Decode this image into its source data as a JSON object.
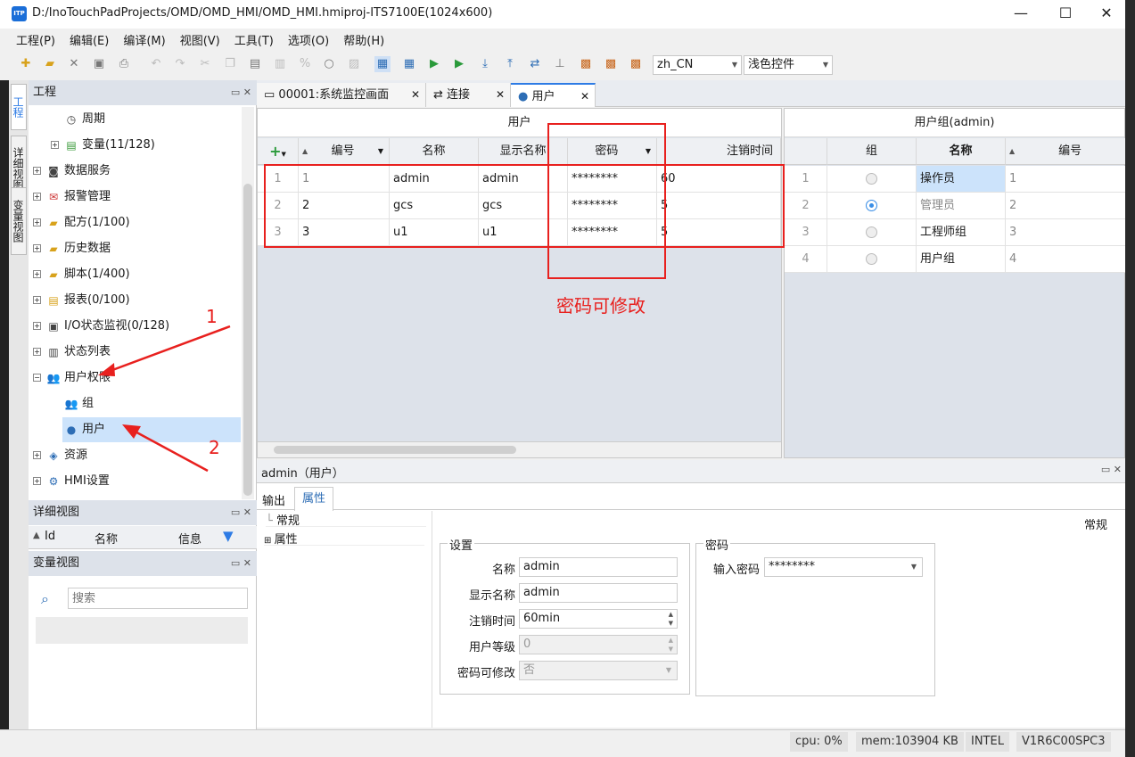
{
  "window": {
    "title": "D:/InoTouchPadProjects/OMD/OMD_HMI/OMD_HMI.hmiproj-ITS7100E(1024x600)",
    "logo": "ITP"
  },
  "menu": [
    "工程(P)",
    "编辑(E)",
    "编译(M)",
    "视图(V)",
    "工具(T)",
    "选项(O)",
    "帮助(H)"
  ],
  "toolbar": {
    "language": "zh_CN",
    "theme": "浅色控件"
  },
  "vtabs": [
    "工程",
    "详细视图",
    "变量视图"
  ],
  "project_panel": {
    "title": "工程",
    "items": [
      {
        "label": "周期",
        "icon": "clock-icon"
      },
      {
        "label": "变量(11/128)",
        "icon": "variable-icon"
      },
      {
        "label": "数据服务",
        "icon": "data-service-icon"
      },
      {
        "label": "报警管理",
        "icon": "alarm-icon"
      },
      {
        "label": "配方(1/100)",
        "icon": "recipe-icon"
      },
      {
        "label": "历史数据",
        "icon": "history-icon"
      },
      {
        "label": "脚本(1/400)",
        "icon": "script-icon"
      },
      {
        "label": "报表(0/100)",
        "icon": "report-icon"
      },
      {
        "label": "I/O状态监视(0/128)",
        "icon": "io-monitor-icon"
      },
      {
        "label": "状态列表",
        "icon": "status-list-icon"
      },
      {
        "label": "用户权限",
        "icon": "users-icon"
      },
      {
        "label": "组",
        "icon": "group-icon"
      },
      {
        "label": "用户",
        "icon": "user-icon"
      },
      {
        "label": "资源",
        "icon": "resource-icon"
      },
      {
        "label": "HMI设置",
        "icon": "hmi-settings-icon"
      }
    ]
  },
  "detail_panel": {
    "title": "详细视图",
    "columns": [
      "Id",
      "名称",
      "信息"
    ]
  },
  "var_panel": {
    "title": "变量视图",
    "search_placeholder": "搜索"
  },
  "doc_tabs": [
    "00001:系统监控画面",
    "连接",
    "用户"
  ],
  "users_grid": {
    "title": "用户",
    "columns": [
      "编号",
      "名称",
      "显示名称",
      "密码",
      "注销时间"
    ],
    "rows": [
      {
        "n": "1",
        "id": "1",
        "name": "admin",
        "display": "admin",
        "pwd": "********",
        "logout": "60"
      },
      {
        "n": "2",
        "id": "2",
        "name": "gcs",
        "display": "gcs",
        "pwd": "********",
        "logout": "5"
      },
      {
        "n": "3",
        "id": "3",
        "name": "u1",
        "display": "u1",
        "pwd": "********",
        "logout": "5"
      }
    ]
  },
  "group_grid": {
    "title": "用户组(admin)",
    "columns": [
      "组",
      "名称",
      "编号"
    ],
    "rows": [
      {
        "n": "1",
        "name": "操作员",
        "id": "1",
        "on": false
      },
      {
        "n": "2",
        "name": "管理员",
        "id": "2",
        "on": true
      },
      {
        "n": "3",
        "name": "工程师组",
        "id": "3",
        "on": false
      },
      {
        "n": "4",
        "name": "用户组",
        "id": "4",
        "on": false
      }
    ]
  },
  "annotations": {
    "pwd_note": "密码可修改",
    "arrow1": "1",
    "arrow2": "2"
  },
  "props": {
    "header": "admin（用户）",
    "tabs": [
      "输出",
      "属性"
    ],
    "tree": [
      "常规",
      "属性"
    ],
    "section": "常规",
    "settings_title": "设置",
    "password_title": "密码",
    "labels": [
      "名称",
      "显示名称",
      "注销时间",
      "用户等级",
      "密码可修改"
    ],
    "values": [
      "admin",
      "admin",
      "60min",
      "0",
      "否"
    ],
    "pwd_label": "输入密码",
    "pwd_value": "********"
  },
  "status": {
    "cpu": "cpu:  0%",
    "mem": "mem:103904 KB",
    "cpu_type": "INTEL",
    "version": "V1R6C00SPC3"
  },
  "colors": {
    "accent": "#2d7be5",
    "annotation": "#e8201e",
    "selection": "#cce3fb"
  }
}
